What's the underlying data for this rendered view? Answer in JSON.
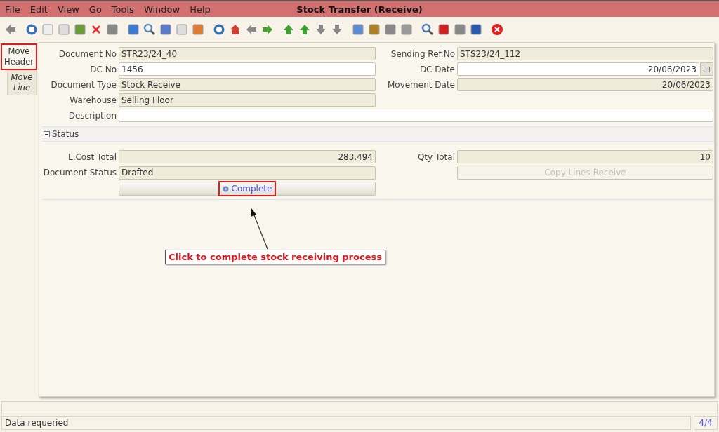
{
  "window": {
    "title": "Stock Transfer (Receive)"
  },
  "menu": [
    "File",
    "Edit",
    "View",
    "Go",
    "Tools",
    "Window",
    "Help"
  ],
  "tabs": [
    {
      "label": "Move Header",
      "selected": true,
      "highlighted": true
    },
    {
      "label": "Move Line",
      "selected": false,
      "highlighted": false
    }
  ],
  "header_fields": [
    [
      {
        "label": "Document No",
        "value": "STR23/24_40",
        "readonly": true,
        "kind": "text"
      },
      {
        "label": "Sending Ref.No",
        "value": "STS23/24_112",
        "readonly": true,
        "kind": "text"
      }
    ],
    [
      {
        "label": "DC No",
        "value": "1456",
        "readonly": false,
        "kind": "text"
      },
      {
        "label": "DC Date",
        "value": "20/06/2023",
        "readonly": false,
        "kind": "date-picker"
      }
    ],
    [
      {
        "label": "Document Type",
        "value": "Stock Receive",
        "readonly": true,
        "kind": "text"
      },
      {
        "label": "Movement Date",
        "value": "20/06/2023",
        "readonly": true,
        "kind": "number"
      }
    ],
    [
      {
        "label": "Warehouse",
        "value": "Selling Floor",
        "readonly": true,
        "kind": "text"
      }
    ]
  ],
  "description": {
    "label": "Description"
  },
  "status_section": {
    "title": "Status",
    "expanded": true,
    "fields": [
      [
        {
          "label": "L.Cost Total",
          "value": "283.494",
          "readonly": true,
          "kind": "number"
        },
        {
          "label": "Qty Total",
          "value": "10",
          "readonly": true,
          "kind": "number"
        }
      ],
      [
        {
          "label": "Document Status",
          "value": "Drafted",
          "readonly": true,
          "kind": "text"
        },
        {
          "label": "Copy Lines Receive",
          "disabled": true,
          "kind": "button"
        }
      ],
      [
        {
          "label": "Complete",
          "disabled": false,
          "highlighted": true,
          "kind": "button"
        }
      ]
    ]
  },
  "annotation": {
    "text": "Click to complete stock receiving process"
  },
  "status_bar": {
    "message": "Data requeried",
    "record": "4/4"
  }
}
